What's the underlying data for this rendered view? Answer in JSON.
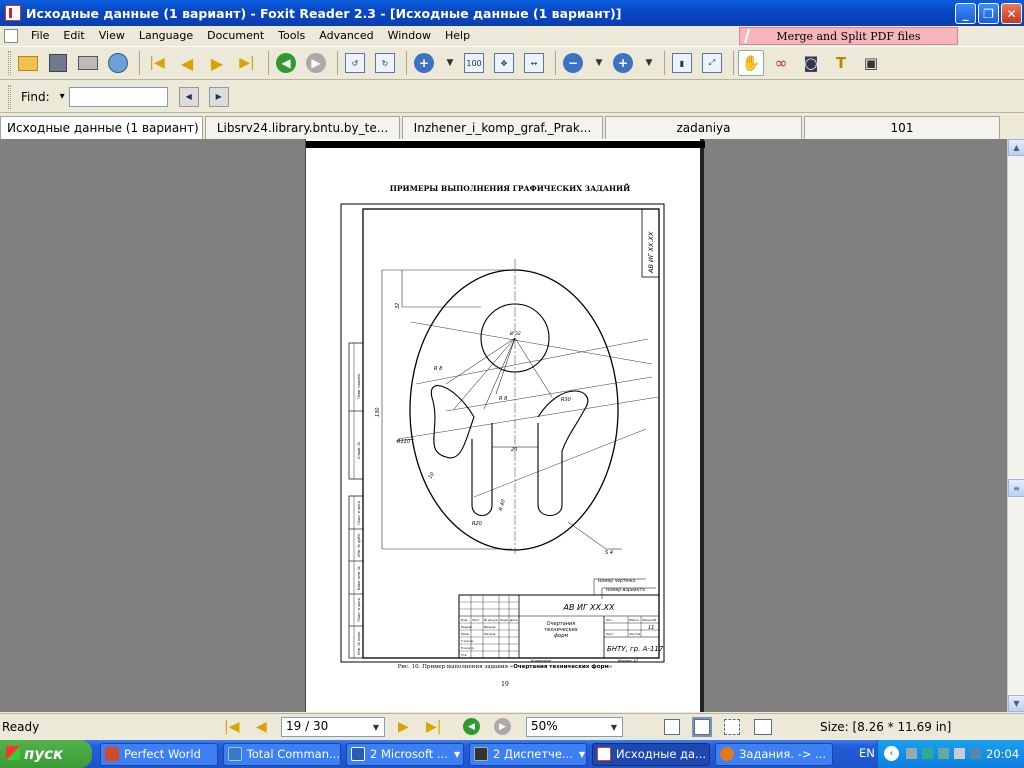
{
  "window": {
    "title": "Исходные данные (1 вариант) - Foxit Reader 2.3 - [Исходные данные (1 вариант)]",
    "minimize": "_",
    "maximize": "❐",
    "close": "✕"
  },
  "menu": {
    "items": [
      "File",
      "Edit",
      "View",
      "Language",
      "Document",
      "Tools",
      "Advanced",
      "Window",
      "Help"
    ],
    "ad_text": "Merge and Split PDF files"
  },
  "find": {
    "label": "Find:",
    "dropdown": "▾",
    "value": ""
  },
  "tabs": [
    {
      "label": "Исходные данные (1 вариант)",
      "close": "✕",
      "active": true
    },
    {
      "label": "Libsrv24.library.bntu.by_te...",
      "close": "",
      "active": false
    },
    {
      "label": "Inzhener_i_komp_graf._Prak...",
      "close": "",
      "active": false
    },
    {
      "label": "zadaniya",
      "close": "",
      "active": false
    },
    {
      "label": "101",
      "close": "",
      "active": false
    }
  ],
  "document": {
    "heading": "ПРИМЕРЫ ВЫПОЛНЕНИЯ ГРАФИЧЕСКИХ ЗАДАНИЙ",
    "caption_prefix": "Рис. 10. Пример выполнения задания «",
    "caption_bold": "Очертания технических форм",
    "caption_suffix": "»",
    "page_number": "19",
    "drawing": {
      "code_vertical": "АВ ИГ XX.XX",
      "stamp_code": "АВ ИГ XX.XX",
      "stamp_title_lines": [
        "Очертания",
        "технических",
        "форм"
      ],
      "stamp_sheet": "11",
      "stamp_org": "БНТУ, гр. А-117",
      "stamp_copied": "Копировал",
      "stamp_format": "Формат  А3",
      "callout_drawing_no": "Номер чертежа",
      "callout_variant_no": "Номер варианта",
      "dims": {
        "d32": "32",
        "d130": "130",
        "r8_top": "R 8",
        "r8_mid": "R 8",
        "r30": "R30",
        "r110": "R110",
        "d20": "20",
        "d10": "10",
        "r20": "R20",
        "r40": "R 40",
        "s4": "S 4",
        "diam32": "Ø 32"
      },
      "side_labels": [
        "Перв. примен.",
        "Справ. №",
        "Подп. и дата",
        "Инв. № дубл.",
        "Взам. инв. №",
        "Подп. и дата",
        "Инв. № подл."
      ],
      "stamp_headers": [
        "Изм.",
        "Лист",
        "№ докум.",
        "Подп.",
        "Дата"
      ],
      "stamp_roles": [
        "Разраб.",
        "Пров.",
        "Т.контр.",
        "Н.контр.",
        "Утв."
      ],
      "stamp_people": [
        "Иванов",
        "Петров"
      ],
      "stamp_lit_headers": [
        "Лит.",
        "Масса",
        "Масштаб"
      ],
      "stamp_sheet_headers": [
        "Лист",
        "Листов"
      ]
    }
  },
  "status": {
    "ready": "Ready",
    "page": "19 / 30",
    "zoom": "50%",
    "size": "Size: [8.26 * 11.69 in]"
  },
  "taskbar": {
    "start": "пуск",
    "tasks": [
      {
        "label": "Perfect World",
        "color": "#d04b2a"
      },
      {
        "label": "Total Comman...",
        "color": "#3a7ac8"
      },
      {
        "label": "2 Microsoft ...",
        "color": "#2a5bb5"
      },
      {
        "label": "2 Диспетче...",
        "color": "#333333"
      },
      {
        "label": "Исходные да...",
        "color": "#d04b2a"
      },
      {
        "label": "Задания. -> ...",
        "color": "#e07820"
      }
    ],
    "lang": "EN",
    "clock": "20:04"
  },
  "colors": {
    "accent": "#0a5fde",
    "ad_bg": "#f6b5bb",
    "viewer_bg": "#808080"
  }
}
